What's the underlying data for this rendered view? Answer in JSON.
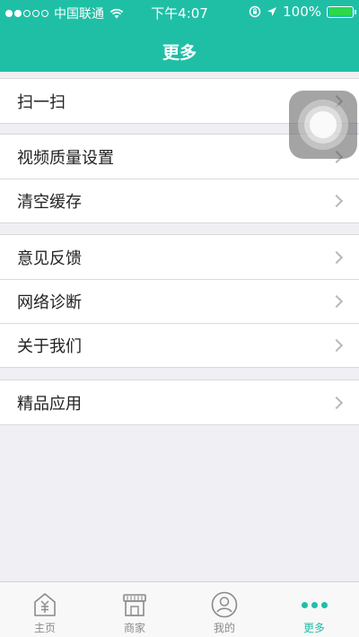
{
  "status_bar": {
    "carrier": "中国联通",
    "time": "下午4:07",
    "battery": "100%"
  },
  "nav": {
    "title": "更多"
  },
  "groups": [
    {
      "items": [
        {
          "label": "扫一扫"
        }
      ]
    },
    {
      "items": [
        {
          "label": "视频质量设置"
        },
        {
          "label": "清空缓存"
        }
      ]
    },
    {
      "items": [
        {
          "label": "意见反馈"
        },
        {
          "label": "网络诊断"
        },
        {
          "label": "关于我们"
        }
      ]
    },
    {
      "items": [
        {
          "label": "精品应用"
        }
      ]
    }
  ],
  "tabs": [
    {
      "label": "主页",
      "icon": "home-yuan-icon",
      "active": false
    },
    {
      "label": "商家",
      "icon": "store-icon",
      "active": false
    },
    {
      "label": "我的",
      "icon": "profile-icon",
      "active": false
    },
    {
      "label": "更多",
      "icon": "more-dots-icon",
      "active": true
    }
  ],
  "colors": {
    "accent": "#1fbfa6",
    "background": "#efeff4"
  }
}
